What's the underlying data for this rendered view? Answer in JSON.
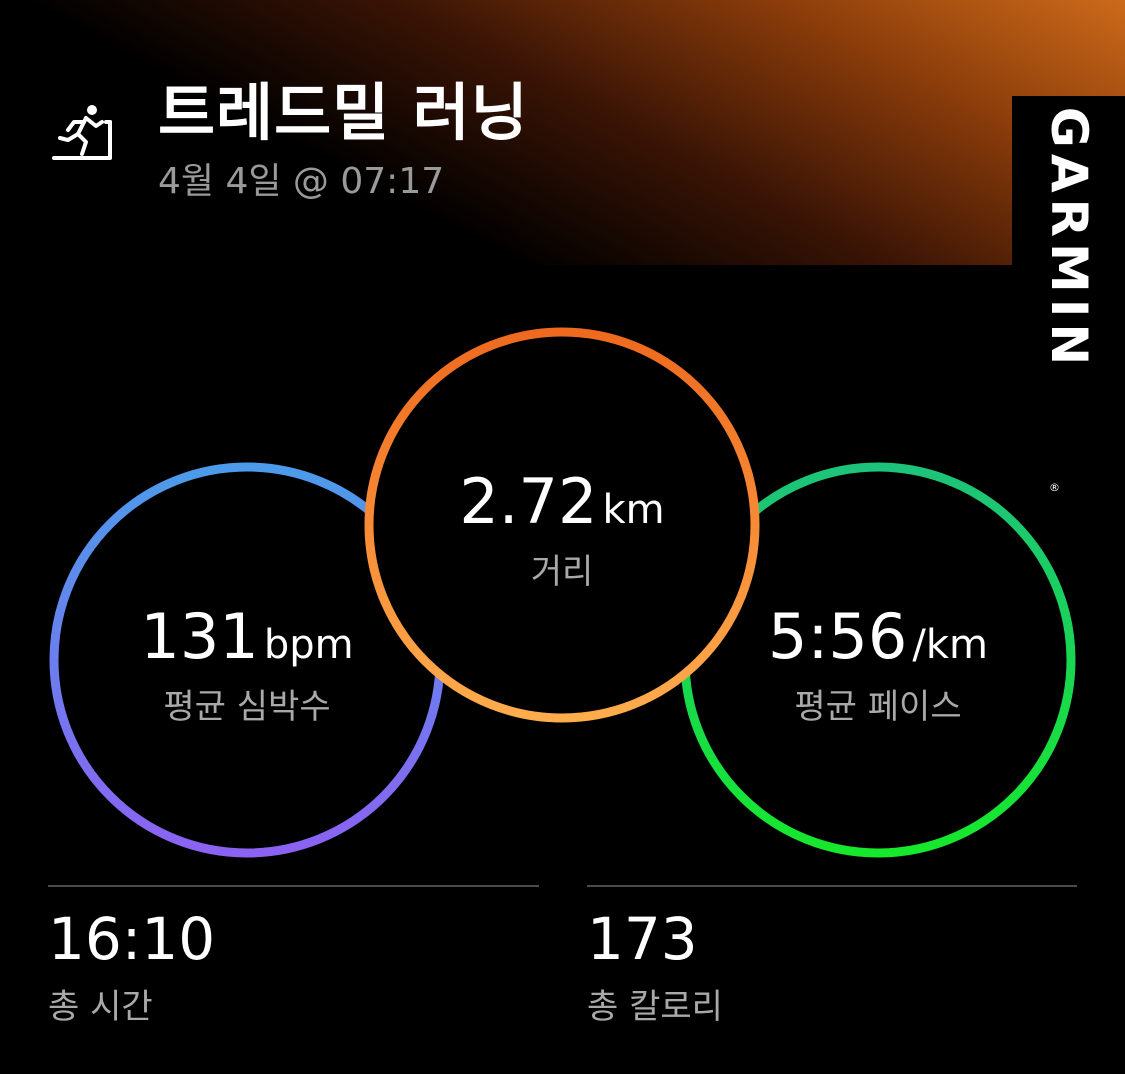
{
  "header": {
    "title": "트레드밀 러닝",
    "subtitle": "4월 4일 @ 07:17",
    "activity_icon": "treadmill-running-icon",
    "brand": "GARMIN",
    "brand_mark": "®"
  },
  "metrics": {
    "heart_rate": {
      "value": "131",
      "unit": "bpm",
      "label": "평균 심박수",
      "colors": [
        "#4c9bea",
        "#8b62f2"
      ]
    },
    "distance": {
      "value": "2.72",
      "unit": "km",
      "label": "거리",
      "colors": [
        "#ee6a1f",
        "#ffac4d"
      ]
    },
    "pace": {
      "value": "5:56",
      "unit": "/km",
      "label": "평균 페이스",
      "colors": [
        "#1dc37a",
        "#16e82c"
      ]
    }
  },
  "stats": {
    "total_time": {
      "value": "16:10",
      "label": "총 시간"
    },
    "calories": {
      "value": "173",
      "label": "총 칼로리"
    }
  }
}
